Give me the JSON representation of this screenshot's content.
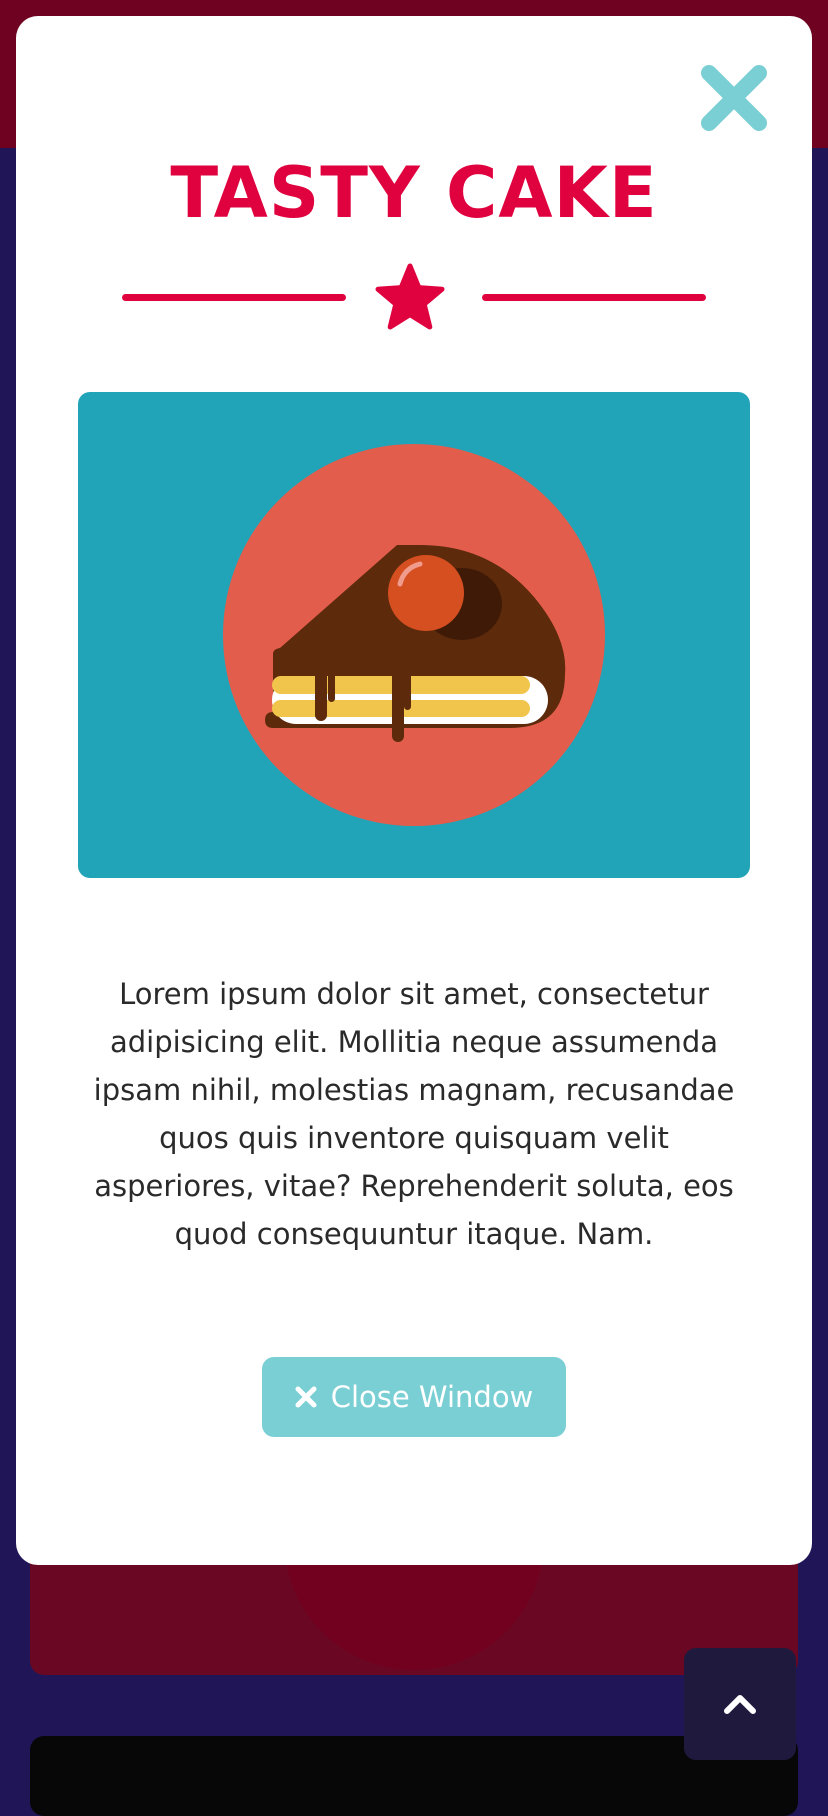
{
  "modal": {
    "title": "TASTY CAKE",
    "description": "Lorem ipsum dolor sit amet, consectetur adipisicing elit. Mollitia neque assumenda ipsam nihil, molestias magnam, recusandae quos quis inventore quisquam velit asperiores, vitae? Reprehenderit soluta, eos quod consequuntur itaque. Nam.",
    "close_button_label": "Close Window",
    "close_button_icon": "times-icon",
    "close_corner_icon": "close-icon",
    "divider_icon": "star-icon",
    "image_subject": "cake-slice-illustration"
  },
  "page": {
    "scroll_top_icon": "chevron-up-icon"
  },
  "colors": {
    "title": "#e0023f",
    "accent": "#7acfd4",
    "image_background": "#21a3b8",
    "image_circle": "#e35d4c",
    "page_background": "#201657",
    "header_background": "#6e0220"
  }
}
